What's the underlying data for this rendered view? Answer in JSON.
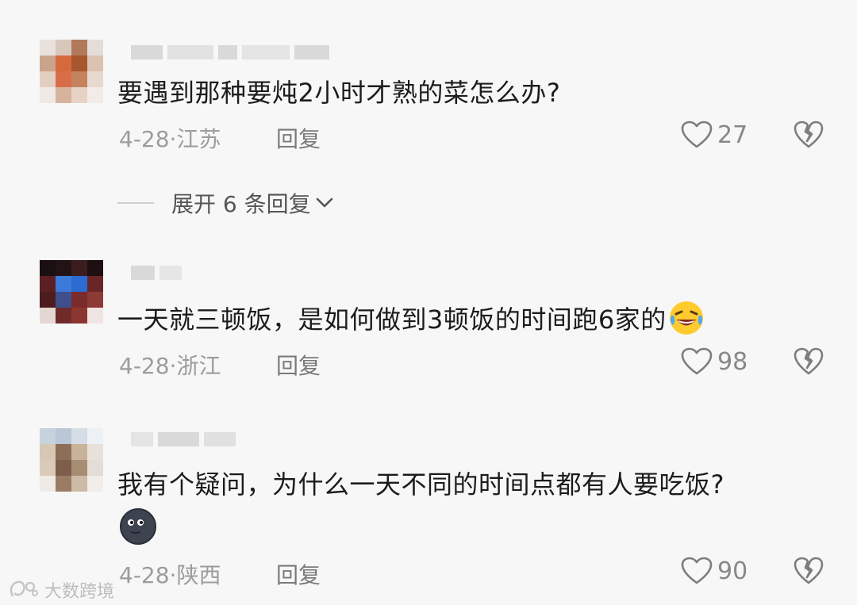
{
  "comments": [
    {
      "text": "要遇到那种要炖2小时才熟的菜怎么办?",
      "date_location": "4-28·江苏",
      "reply_label": "回复",
      "likes": "27",
      "expand_replies": "展开 6 条回复"
    },
    {
      "text": "一天就三顿饭，是如何做到3顿饭的时间跑6家的",
      "date_location": "4-28·浙江",
      "reply_label": "回复",
      "likes": "98"
    },
    {
      "text": "我有个疑问，为什么一天不同的时间点都有人要吃饭?",
      "date_location": "4-28·陕西",
      "reply_label": "回复",
      "likes": "90"
    }
  ],
  "watermark": "大数跨境",
  "colors": {
    "background": "#f7f7f7",
    "text": "#1c1c1c",
    "meta": "#9c9c9c"
  }
}
